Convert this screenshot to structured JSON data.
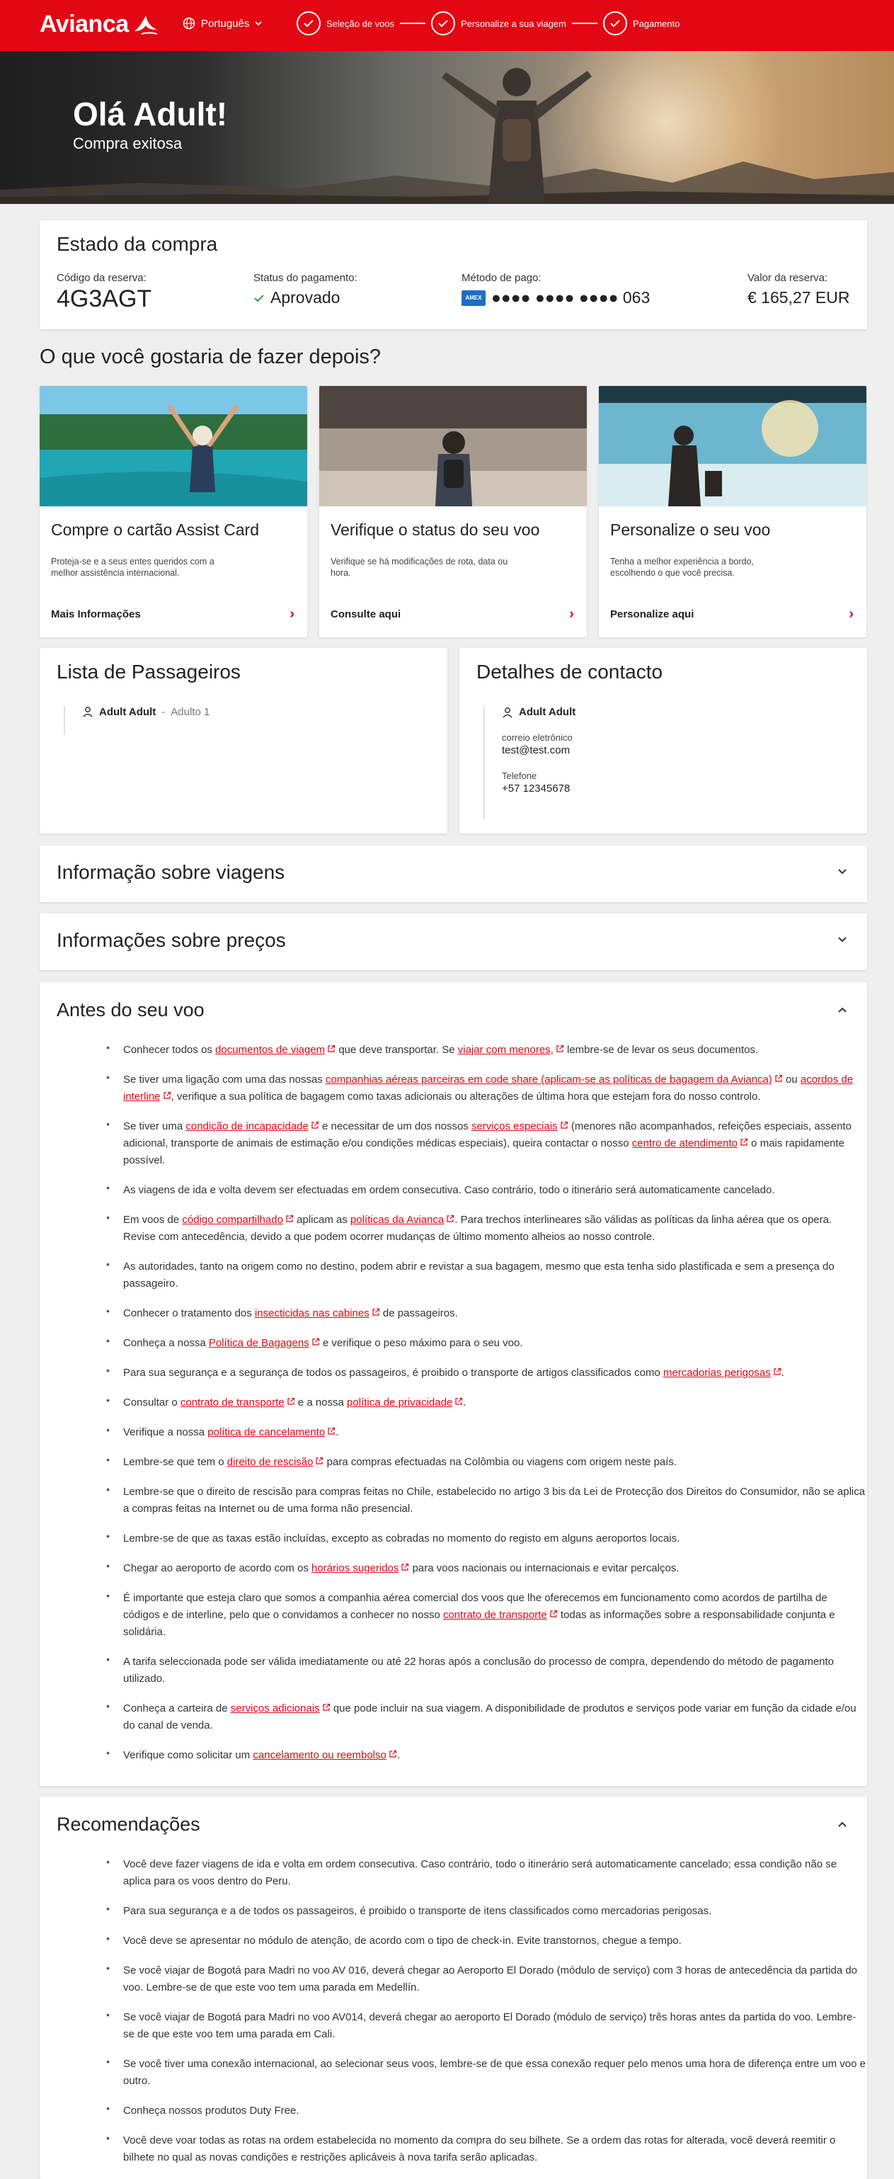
{
  "header": {
    "logo": "Avianca",
    "language": "Português",
    "steps": [
      "Seleção de voos",
      "Personalize a sua viagem",
      "Pagamento"
    ]
  },
  "hero": {
    "title": "Olá Adult!",
    "subtitle": "Compra exitosa"
  },
  "status": {
    "title": "Estado da compra",
    "code_label": "Código da reserva:",
    "code_value": "4G3AGT",
    "payment_label": "Status do pagamento:",
    "payment_value": "Aprovado",
    "method_label": "Método de pago:",
    "card_brand": "AMEX",
    "method_value": "●●●● ●●●● ●●●● 063",
    "amount_label": "Valor da reserva:",
    "amount_value": "€ 165,27 EUR"
  },
  "next": {
    "title": "O que você gostaria de fazer depois?",
    "cards": [
      {
        "title": "Compre o cartão Assist Card",
        "text": "Proteja-se e a seus entes queridos com a melhor assistência internacional.",
        "link": "Mais Informações"
      },
      {
        "title": "Verifique o status do seu voo",
        "text": "Verifique se há modificações de rota, data ou hora.",
        "link": "Consulte aqui"
      },
      {
        "title": "Personalize o seu voo",
        "text": "Tenha a melhor experiência a bordo, escolhendo o que você precisa.",
        "link": "Personalize aqui"
      }
    ]
  },
  "passengers": {
    "title": "Lista de Passageiros",
    "name": "Adult Adult",
    "separator": "-",
    "type": "Adulto 1"
  },
  "contact": {
    "title": "Detalhes de contacto",
    "name": "Adult Adult",
    "email_label": "correio eletrônico",
    "email": "test@test.com",
    "phone_label": "Telefone",
    "phone": "+57 12345678"
  },
  "accordions": {
    "travel": "Informação sobre viagens",
    "prices": "Informações sobre preços"
  },
  "before": {
    "title": "Antes do seu voo",
    "items": [
      {
        "t1": "Conhecer todos os ",
        "l1": "documentos de viagem",
        "t2": " que deve transportar. Se ",
        "l2": "viajar com menores,",
        "t3": " lembre-se de levar os seus documentos."
      },
      {
        "t1": "Se tiver uma ligação com uma das nossas ",
        "l1": "companhias aéreas parceiras em code share (aplicam-se as políticas de bagagem da Avianca)",
        "t2": " ou ",
        "l2": "acordos de interline",
        "t3": ", verifique a sua política de bagagem como taxas adicionais ou alterações de última hora que estejam fora do nosso controlo."
      },
      {
        "t1": "Se tiver uma ",
        "l1": "condição de incapacidade",
        "t2": " e necessitar de um dos nossos ",
        "l2": "serviços especiais",
        "t3": " (menores não acompanhados, refeições especiais, assento adicional, transporte de animais de estimação e/ou condições médicas especiais), queira contactar o nosso ",
        "l3": "centro de atendimento",
        "t4": " o mais rapidamente possível."
      },
      {
        "t1": "As viagens de ida e volta devem ser efectuadas em ordem consecutiva. Caso contrário, todo o itinerário será automaticamente cancelado."
      },
      {
        "t1": "Em voos de ",
        "l1": "código compartilhado",
        "t2": " aplicam as ",
        "l2": "políticas da Avianca",
        "t3": ". Para trechos interlineares são válidas as políticas da linha aérea que os opera. Revise com antecedência, devido a que podem ocorrer mudanças de último momento alheios ao nosso controle."
      },
      {
        "t1": "As autoridades, tanto na origem como no destino, podem abrir e revistar a sua bagagem, mesmo que esta tenha sido plastificada e sem a presença do passageiro."
      },
      {
        "t1": "Conhecer o tratamento dos ",
        "l1": "insecticidas nas cabines",
        "t2": " de passageiros."
      },
      {
        "t1": "Conheça a nossa ",
        "l1": "Política de Bagagens",
        "t2": " e verifique o peso máximo para o seu voo."
      },
      {
        "t1": "Para sua segurança e a segurança de todos os passageiros, é proibido o transporte de artigos classificados como ",
        "l1": "mercadorias perigosas",
        "t2": "."
      },
      {
        "t1": "Consultar o ",
        "l1": "contrato de transporte",
        "t2": " e a nossa ",
        "l2": "política de privacidade",
        "t3": "."
      },
      {
        "t1": "Verifique a nossa ",
        "l1": "política de cancelamento",
        "t2": "."
      },
      {
        "t1": "Lembre-se que tem o ",
        "l1": "direito de rescisão",
        "t2": " para compras efectuadas na Colômbia ou viagens com origem neste país."
      },
      {
        "t1": "Lembre-se que o direito de rescisão para compras feitas no Chile, estabelecido no artigo 3 bis da Lei de Protecção dos Direitos do Consumidor, não se aplica a compras feitas na Internet ou de uma forma não presencial."
      },
      {
        "t1": "Lembre-se de que as taxas estão incluídas, excepto as cobradas no momento do registo em alguns aeroportos locais."
      },
      {
        "t1": "Chegar ao aeroporto de acordo com os ",
        "l1": "horários sugeridos",
        "t2": " para voos nacionais ou internacionais e evitar percalços."
      },
      {
        "t1": "É importante que esteja claro que somos a companhia aérea comercial dos voos que lhe oferecemos em funcionamento como acordos de partilha de códigos e de interline, pelo que o convidamos a conhecer no nosso ",
        "l1": "contrato de transporte",
        "t2": " todas as informações sobre a responsabilidade conjunta e solidária."
      },
      {
        "t1": "A tarifa seleccionada pode ser válida imediatamente ou até 22 horas após a conclusão do processo de compra, dependendo do método de pagamento utilizado."
      },
      {
        "t1": "Conheça a carteira de ",
        "l1": "serviços adicionais",
        "t2": " que pode incluir na sua viagem. A disponibilidade de produtos e serviços pode variar em função da cidade e/ou do canal de venda."
      },
      {
        "t1": "Verifique como solicitar um ",
        "l1": "cancelamento ou reembolso",
        "t2": "."
      }
    ]
  },
  "recommendations": {
    "title": "Recomendações",
    "items": [
      "Você deve fazer viagens de ida e volta em ordem consecutiva. Caso contrário, todo o itinerário será automaticamente cancelado; essa condição não se aplica para os voos dentro do Peru.",
      "Para sua segurança e a de todos os passageiros, é proibido o transporte de itens classificados como mercadorias perigosas.",
      "Você deve se apresentar no módulo de atenção, de acordo com o tipo de check-in. Evite transtornos, chegue a tempo.",
      "Se você viajar de Bogotá para Madri no voo AV 016, deverá chegar ao Aeroporto El Dorado (módulo de serviço) com 3 horas de antecedência da partida do voo. Lembre-se de que este voo tem uma parada em Medellín.",
      "Se você viajar de Bogotá para Madri no voo AV014, deverá chegar ao aeroporto El Dorado (módulo de serviço) três horas antes da partida do voo. Lembre-se de que este voo tem uma parada em Cali.",
      "Se você tiver uma conexão internacional, ao selecionar seus voos, lembre-se de que essa conexão requer pelo menos uma hora de diferença entre um voo e outro.",
      "Conheça nossos produtos Duty Free.",
      "Você deve voar todas as rotas na ordem estabelecida no momento da compra do seu bilhete. Se a ordem das rotas for alterada, você deverá reemitir o bilhete no qual as novas condições e restrições aplicáveis à nova tarifa serão aplicadas."
    ]
  }
}
